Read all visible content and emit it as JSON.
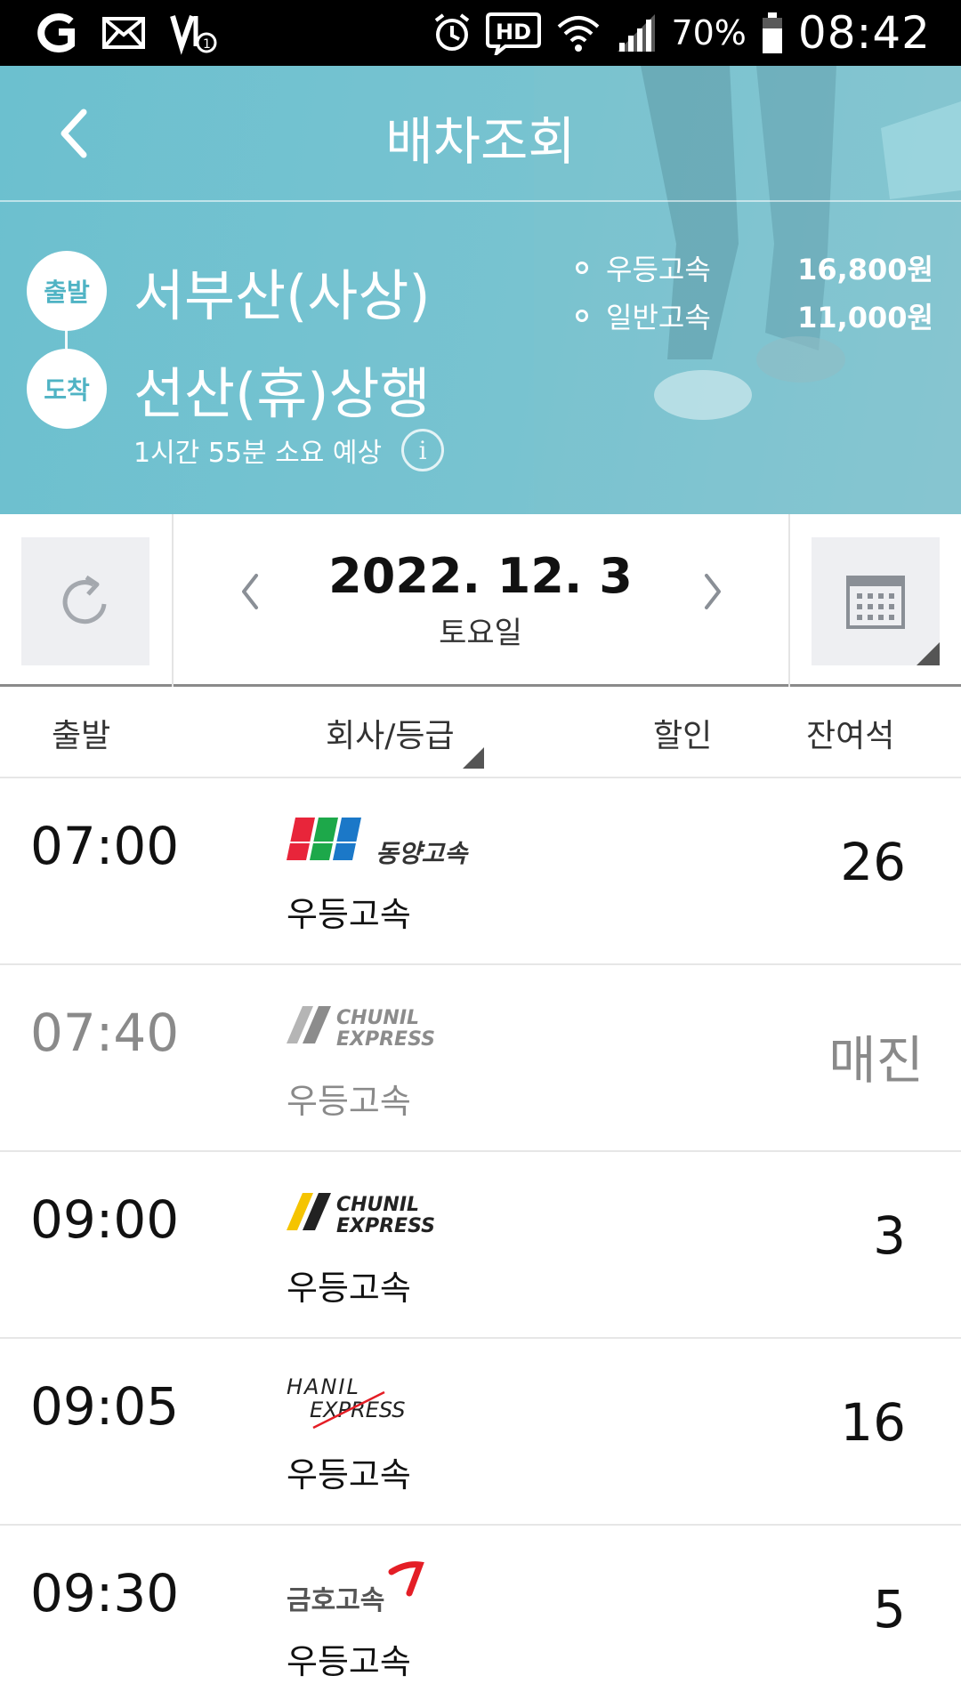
{
  "status_bar": {
    "battery": "70%",
    "time": "08:42",
    "hd_label": "HD"
  },
  "header": {
    "title": "배차조회",
    "departure_badge": "출발",
    "arrival_badge": "도착",
    "departure": "서부산(사상)",
    "arrival": "선산(휴)상행",
    "duration": "1시간 55분 소요 예상",
    "fares": [
      {
        "grade": "우등고속",
        "price": "16,800원"
      },
      {
        "grade": "일반고속",
        "price": "11,000원"
      }
    ]
  },
  "date_bar": {
    "date": "2022. 12. 3",
    "weekday": "토요일"
  },
  "table": {
    "headers": {
      "departure": "출발",
      "company": "회사/등급",
      "discount": "할인",
      "seats": "잔여석"
    },
    "rows": [
      {
        "time": "07:00",
        "company": "동양고속",
        "grade": "우등고속",
        "seats": "26",
        "sold_out": false
      },
      {
        "time": "07:40",
        "company": "CHUNIL EXPRESS",
        "grade": "우등고속",
        "seats": "매진",
        "sold_out": true
      },
      {
        "time": "09:00",
        "company": "CHUNIL EXPRESS",
        "grade": "우등고속",
        "seats": "3",
        "sold_out": false
      },
      {
        "time": "09:05",
        "company": "HANIL EXPRESS",
        "grade": "우등고속",
        "seats": "16",
        "sold_out": false
      },
      {
        "time": "09:30",
        "company": "금호고속",
        "grade": "우등고속",
        "seats": "5",
        "sold_out": false
      }
    ]
  },
  "colors": {
    "header_bg": "#6cc0cf",
    "badge_text": "#4fb3c4",
    "sold_out": "#8a8a8a",
    "dongyang_red": "#e8253a",
    "dongyang_green": "#1da84a",
    "dongyang_blue": "#1b78c8",
    "chunil_yellow": "#f5c400",
    "kumho_red": "#e41e26"
  }
}
